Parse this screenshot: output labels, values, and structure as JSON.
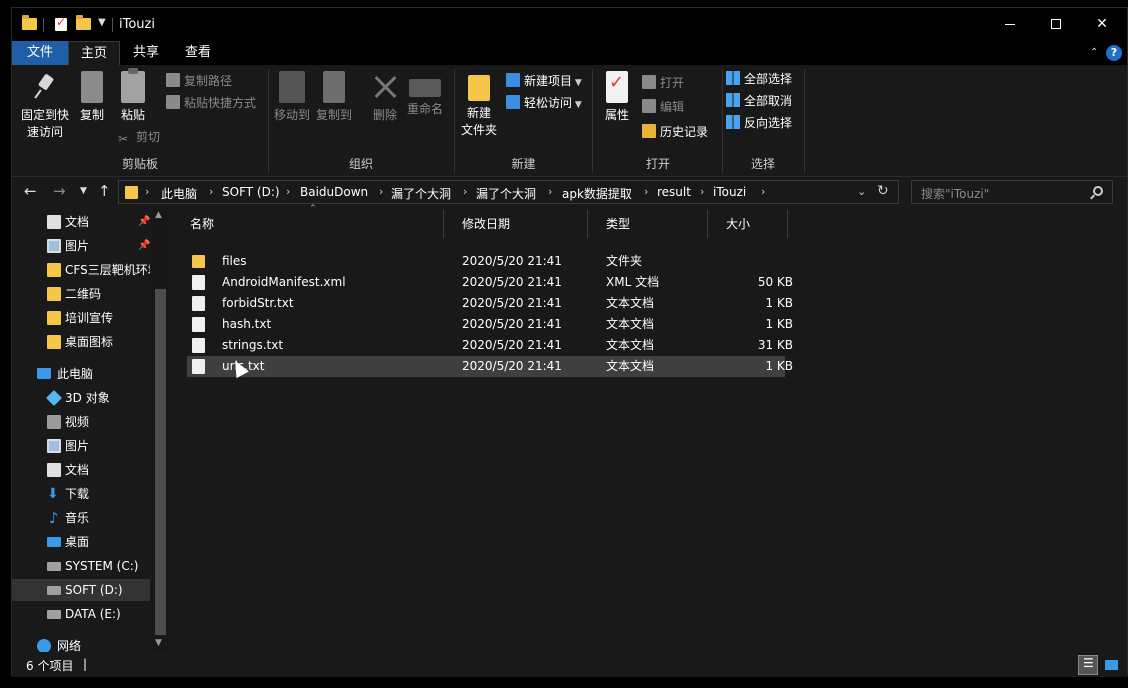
{
  "window": {
    "title": "iTouzi"
  },
  "tabs": {
    "file": "文件",
    "home": "主页",
    "share": "共享",
    "view": "查看"
  },
  "ribbon": {
    "clipboard": {
      "label": "剪贴板",
      "pin": "固定到快\n速访问",
      "pin_l1": "固定到快",
      "pin_l2": "速访问",
      "copy": "复制",
      "paste": "粘贴",
      "copy_path": "复制路径",
      "paste_shortcut": "粘贴快捷方式",
      "cut": "剪切"
    },
    "organize": {
      "label": "组织",
      "move_to": "移动到",
      "copy_to": "复制到",
      "delete": "删除",
      "rename": "重命名"
    },
    "new": {
      "label": "新建",
      "new_folder_l1": "新建",
      "new_folder_l2": "文件夹",
      "new_item": "新建项目",
      "easy_access": "轻松访问"
    },
    "open": {
      "label": "打开",
      "properties": "属性",
      "open": "打开",
      "edit": "编辑",
      "history": "历史记录"
    },
    "select": {
      "label": "选择",
      "select_all": "全部选择",
      "select_none": "全部取消",
      "invert": "反向选择"
    }
  },
  "address": {
    "breadcrumbs": [
      "此电脑",
      "SOFT (D:)",
      "BaiduDown",
      "漏了个大洞",
      "漏了个大洞",
      "apk数据提取",
      "result",
      "iTouzi"
    ],
    "search_placeholder": "搜索\"iTouzi\""
  },
  "nav": {
    "items": [
      {
        "label": "文档",
        "icon": "documents-icon",
        "pinned": true
      },
      {
        "label": "图片",
        "icon": "pictures-icon",
        "pinned": true
      },
      {
        "label": "CFS三层靶机环境",
        "icon": "folder-icon"
      },
      {
        "label": "二维码",
        "icon": "folder-icon"
      },
      {
        "label": "培训宣传",
        "icon": "folder-icon"
      },
      {
        "label": "桌面图标",
        "icon": "folder-icon"
      },
      {
        "label": "此电脑",
        "icon": "this-pc-icon"
      },
      {
        "label": "3D 对象",
        "icon": "3d-objects-icon"
      },
      {
        "label": "视频",
        "icon": "videos-icon"
      },
      {
        "label": "图片",
        "icon": "pictures-icon"
      },
      {
        "label": "文档",
        "icon": "documents-icon"
      },
      {
        "label": "下载",
        "icon": "downloads-icon"
      },
      {
        "label": "音乐",
        "icon": "music-icon"
      },
      {
        "label": "桌面",
        "icon": "desktop-icon"
      },
      {
        "label": "SYSTEM (C:)",
        "icon": "drive-icon"
      },
      {
        "label": "SOFT (D:)",
        "icon": "drive-icon",
        "selected": true
      },
      {
        "label": "DATA (E:)",
        "icon": "drive-icon"
      },
      {
        "label": "网络",
        "icon": "network-icon"
      }
    ]
  },
  "list": {
    "columns": {
      "name": "名称",
      "date": "修改日期",
      "type": "类型",
      "size": "大小"
    },
    "rows": [
      {
        "name": "files",
        "date": "2020/5/20 21:41",
        "type": "文件夹",
        "size": "",
        "icon": "folder-icon"
      },
      {
        "name": "AndroidManifest.xml",
        "date": "2020/5/20 21:41",
        "type": "XML 文档",
        "size": "50 KB",
        "icon": "file-icon"
      },
      {
        "name": "forbidStr.txt",
        "date": "2020/5/20 21:41",
        "type": "文本文档",
        "size": "1 KB",
        "icon": "file-icon"
      },
      {
        "name": "hash.txt",
        "date": "2020/5/20 21:41",
        "type": "文本文档",
        "size": "1 KB",
        "icon": "file-icon"
      },
      {
        "name": "strings.txt",
        "date": "2020/5/20 21:41",
        "type": "文本文档",
        "size": "31 KB",
        "icon": "file-icon"
      },
      {
        "name": "urls.txt",
        "date": "2020/5/20 21:41",
        "type": "文本文档",
        "size": "1 KB",
        "icon": "file-icon",
        "selected": true
      }
    ]
  },
  "status": {
    "count": "6 个项目",
    "separator": "|"
  },
  "colors": {
    "accent": "#1f5fa9",
    "background": "#191919",
    "folder": "#f5c64a"
  }
}
